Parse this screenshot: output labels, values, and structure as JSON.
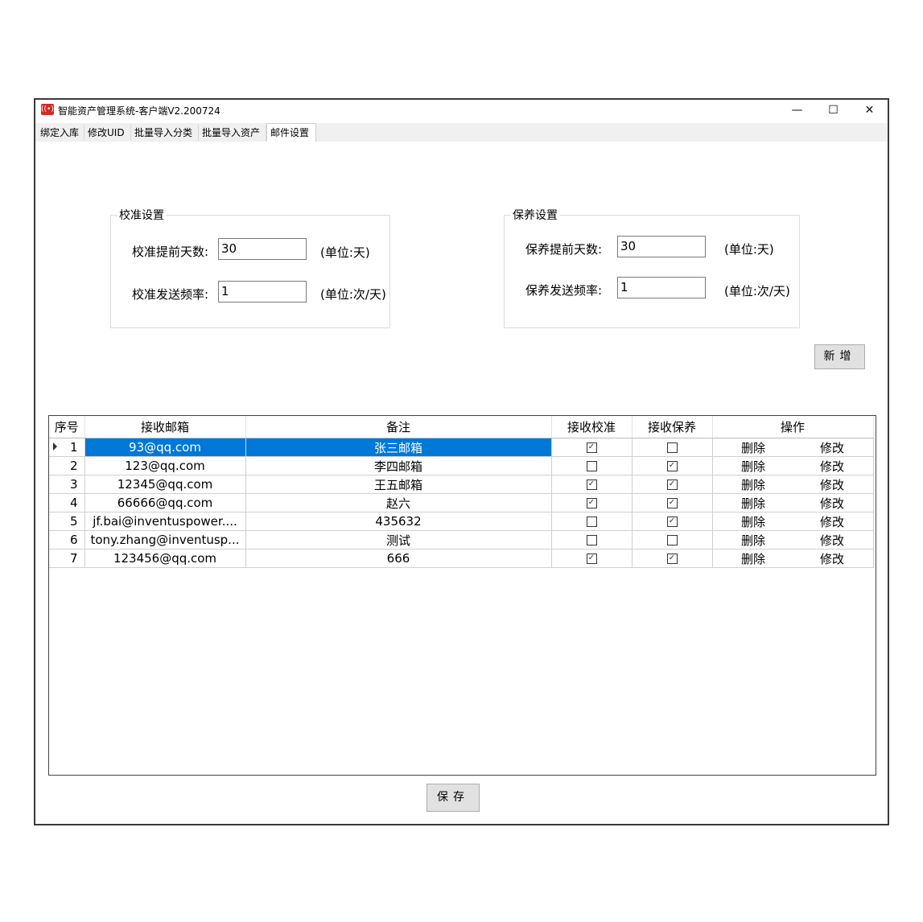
{
  "window": {
    "title": "智能资产管理系统-客户端V2.200724",
    "minimize_glyph": "—",
    "maximize_glyph": "☐",
    "close_glyph": "✕",
    "icon": "app-logo-icon"
  },
  "tabs": [
    {
      "label": "绑定入库"
    },
    {
      "label": "修改UID"
    },
    {
      "label": "批量导入分类"
    },
    {
      "label": "批量导入资产"
    },
    {
      "label": "邮件设置",
      "active": true
    }
  ],
  "calibration": {
    "title": "校准设置",
    "days_label": "校准提前天数:",
    "days_value": "30",
    "days_unit": "(单位:天)",
    "freq_label": "校准发送频率:",
    "freq_value": "1",
    "freq_unit": "(单位:次/天)"
  },
  "maintenance": {
    "title": "保养设置",
    "days_label": "保养提前天数:",
    "days_value": "30",
    "days_unit": "(单位:天)",
    "freq_label": "保养发送频率:",
    "freq_value": "1",
    "freq_unit": "(单位:次/天)"
  },
  "add_button": "新增",
  "save_button": "保存",
  "table": {
    "columns": [
      "序号",
      "接收邮箱",
      "备注",
      "接收校准",
      "接收保养",
      "操作"
    ],
    "rows": [
      {
        "no": "1",
        "email": "93@qq.com",
        "note": "张三邮箱",
        "calib": true,
        "maint": false,
        "del": "删除",
        "edit": "修改"
      },
      {
        "no": "2",
        "email": "123@qq.com",
        "note": "李四邮箱",
        "calib": false,
        "maint": true,
        "del": "删除",
        "edit": "修改"
      },
      {
        "no": "3",
        "email": "12345@qq.com",
        "note": "王五邮箱",
        "calib": true,
        "maint": true,
        "del": "删除",
        "edit": "修改"
      },
      {
        "no": "4",
        "email": "66666@qq.com",
        "note": "赵六",
        "calib": true,
        "maint": true,
        "del": "删除",
        "edit": "修改"
      },
      {
        "no": "5",
        "email": "jf.bai@inventuspower....",
        "note": "435632",
        "calib": false,
        "maint": true,
        "del": "删除",
        "edit": "修改"
      },
      {
        "no": "6",
        "email": "tony.zhang@inventusp...",
        "note": "测试",
        "calib": false,
        "maint": false,
        "del": "删除",
        "edit": "修改"
      },
      {
        "no": "7",
        "email": "123456@qq.com",
        "note": "666",
        "calib": true,
        "maint": true,
        "del": "删除",
        "edit": "修改"
      }
    ],
    "selected_row": 0
  },
  "colors": {
    "selection": "#0078d7",
    "button_bg": "#e1e1e1",
    "app_icon": "#d52a26"
  }
}
